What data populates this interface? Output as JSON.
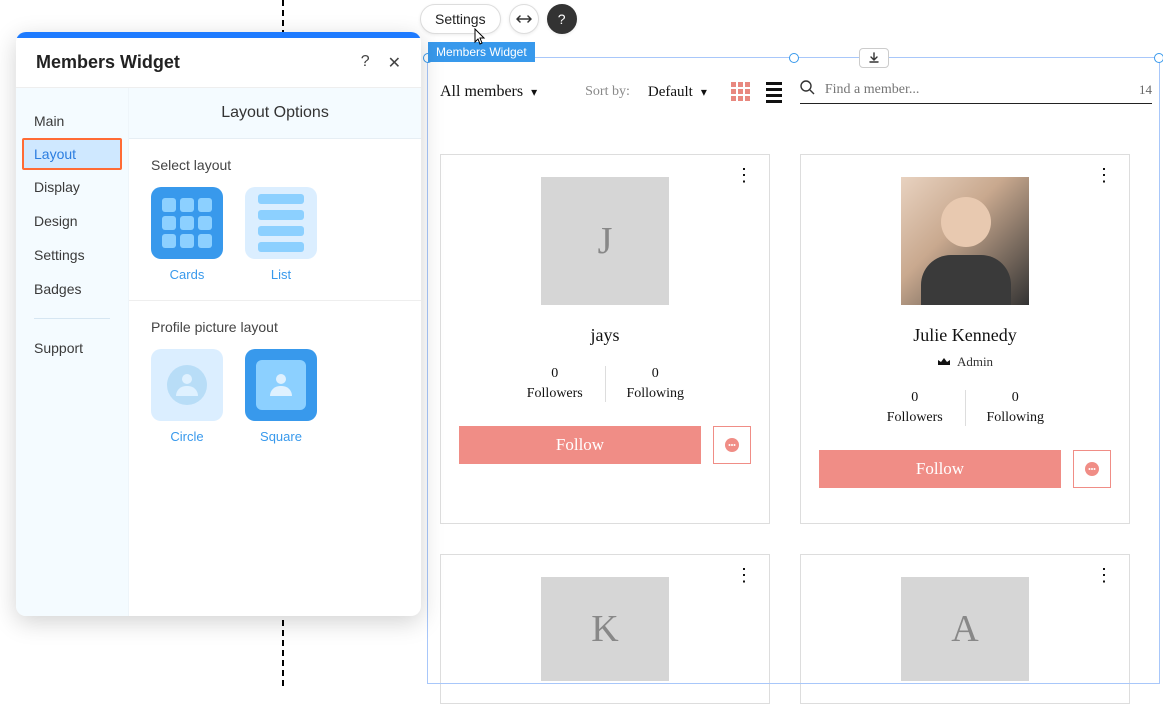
{
  "toolbar": {
    "settings_label": "Settings"
  },
  "widget_tag": "Members Widget",
  "panel": {
    "title": "Members Widget",
    "sidebar": {
      "items": [
        {
          "label": "Main"
        },
        {
          "label": "Layout"
        },
        {
          "label": "Display"
        },
        {
          "label": "Design"
        },
        {
          "label": "Settings"
        },
        {
          "label": "Badges"
        }
      ],
      "support_label": "Support"
    },
    "content": {
      "tab_header": "Layout Options",
      "select_layout_label": "Select layout",
      "layout_options": {
        "cards": "Cards",
        "list": "List"
      },
      "profile_picture_label": "Profile picture layout",
      "profile_options": {
        "circle": "Circle",
        "square": "Square"
      }
    }
  },
  "members": {
    "filter_label": "All members",
    "sort_by_label": "Sort by:",
    "sort_value": "Default",
    "search_placeholder": "Find a member...",
    "count": "14",
    "followers_label": "Followers",
    "following_label": "Following",
    "follow_button": "Follow",
    "admin_label": "Admin",
    "cards": [
      {
        "initial": "J",
        "name": "jays",
        "followers": "0",
        "following": "0",
        "is_admin": false,
        "has_photo": false
      },
      {
        "initial": "",
        "name": "Julie Kennedy",
        "followers": "0",
        "following": "0",
        "is_admin": true,
        "has_photo": true
      },
      {
        "initial": "K",
        "name": "",
        "followers": "",
        "following": "",
        "is_admin": false,
        "has_photo": false
      },
      {
        "initial": "A",
        "name": "",
        "followers": "",
        "following": "",
        "is_admin": false,
        "has_photo": false
      }
    ]
  }
}
